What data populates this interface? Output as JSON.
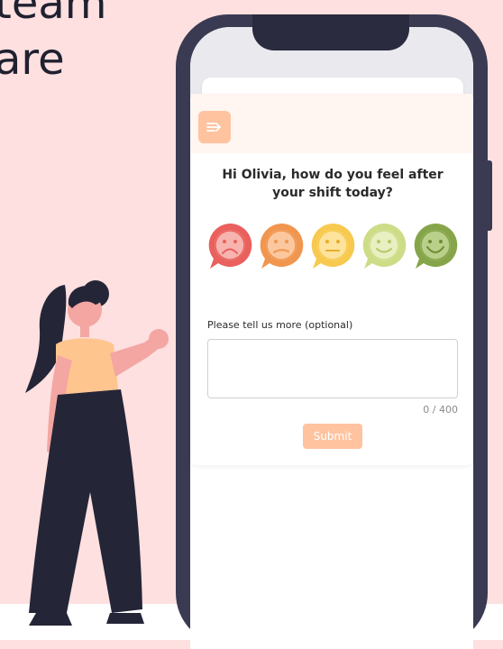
{
  "background": {
    "line1": "team",
    "line2": "are"
  },
  "colors": {
    "page_bg": "#fde0df",
    "phone_frame": "#3a3a52",
    "accent": "#ffc3a0",
    "rating_colors": [
      "#e9605d",
      "#f0964f",
      "#f7c94f",
      "#cddc87",
      "#86a54a"
    ]
  },
  "app": {
    "menu_icon": "menu-arrow-icon",
    "question": "Hi Olivia, how do you feel after your shift today?",
    "ratings": [
      {
        "name": "very-sad",
        "icon": "very-sad-face-icon"
      },
      {
        "name": "sad",
        "icon": "sad-face-icon"
      },
      {
        "name": "neutral",
        "icon": "neutral-face-icon"
      },
      {
        "name": "happy",
        "icon": "happy-face-icon"
      },
      {
        "name": "very-happy",
        "icon": "very-happy-face-icon"
      }
    ],
    "more_label": "Please tell us more (optional)",
    "feedback_value": "",
    "counter": "0 / 400",
    "submit_label": "Submit"
  }
}
